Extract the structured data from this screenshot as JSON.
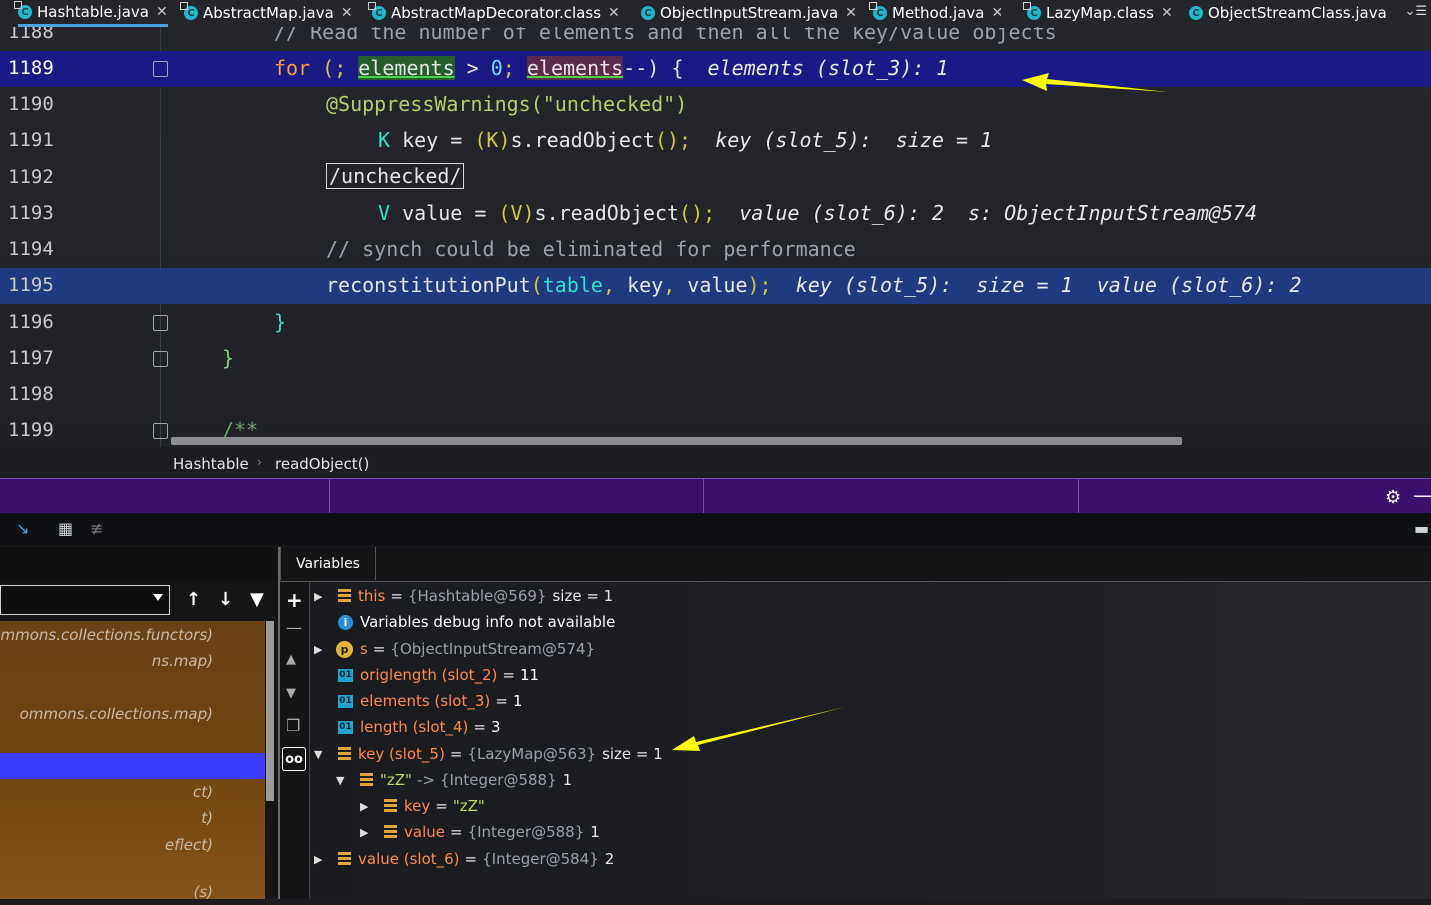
{
  "tabs": [
    {
      "label": "Hashtable.java",
      "active": true
    },
    {
      "label": "AbstractMap.java"
    },
    {
      "label": "AbstractMapDecorator.class"
    },
    {
      "label": "ObjectInputStream.java"
    },
    {
      "label": "Method.java"
    },
    {
      "label": "LazyMap.class"
    },
    {
      "label": "ObjectStreamClass.java"
    }
  ],
  "editor": {
    "lines": {
      "l1188": {
        "num": "1188",
        "comment": "// Read the number of elements and then all the key/value objects"
      },
      "l1189": {
        "num": "1189",
        "kw_for": "for",
        "p1": "(; ",
        "v1": "elements",
        "op1": " > ",
        "n0": "0",
        "sc": "; ",
        "v2": "elements",
        "op2": "--) {",
        "hint": "elements (slot_3): 1"
      },
      "l1190": {
        "num": "1190",
        "annotation": "@SuppressWarnings",
        "ann_arg": "(\"unchecked\")"
      },
      "l1191": {
        "num": "1191",
        "type": "K",
        "rest1": " key = ",
        "cast": "(K)",
        "call": "s.readObject",
        "paren": "();",
        "hint": "key (slot_5):  size = 1"
      },
      "l1192": {
        "num": "1192",
        "boxed": "/unchecked/"
      },
      "l1193": {
        "num": "1193",
        "type": "V",
        "rest1": " value = ",
        "cast": "(V)",
        "call": "s.readObject",
        "paren": "();",
        "hint": "value (slot_6): 2  s: ObjectInputStream@574"
      },
      "l1194": {
        "num": "1194",
        "comment": "// synch could be eliminated for performance"
      },
      "l1195": {
        "num": "1195",
        "call": "reconstitutionPut",
        "open": "(",
        "a1": "table",
        "c1": ", ",
        "a2": "key",
        "c2": ", ",
        "a3": "value",
        "close": ");",
        "hint": "key (slot_5):  size = 1  value (slot_6): 2"
      },
      "l1196": {
        "num": "1196",
        "code": "}"
      },
      "l1197": {
        "num": "1197",
        "code": "}"
      },
      "l1198": {
        "num": "1198",
        "code": ""
      },
      "l1199": {
        "num": "1199",
        "code": "/**"
      }
    }
  },
  "breadcrumb": {
    "item1": "Hashtable",
    "sep": "›",
    "item2": "readObject()"
  },
  "variables_panel": {
    "tab_label": "Variables",
    "rows": {
      "r_this": {
        "name": "this",
        "eq": "=",
        "type": "{Hashtable@569}",
        "val": "size = 1"
      },
      "r_info": {
        "text": "Variables debug info not available"
      },
      "r_s": {
        "name": "s",
        "eq": "=",
        "type": "{ObjectInputStream@574}"
      },
      "r_orig": {
        "name": "origlength (slot_2)",
        "eq": "=",
        "val": "11"
      },
      "r_elem": {
        "name": "elements (slot_3)",
        "eq": "=",
        "val": "1"
      },
      "r_len": {
        "name": "length (slot_4)",
        "eq": "=",
        "val": "3"
      },
      "r_key": {
        "name": "key (slot_5)",
        "eq": "=",
        "type": "{LazyMap@563}",
        "val": "size = 1"
      },
      "r_zz": {
        "name": "\"zZ\"",
        "eq": "->",
        "type": "{Integer@588}",
        "val": "1"
      },
      "r_k": {
        "name": "key",
        "eq": "=",
        "val": "\"zZ\""
      },
      "r_v": {
        "name": "value",
        "eq": "=",
        "type": "{Integer@588}",
        "val": "1"
      },
      "r_value": {
        "name": "value (slot_6)",
        "eq": "=",
        "type": "{Integer@584}",
        "val": "2"
      }
    }
  },
  "frames_panel": {
    "items": [
      "ommons.collections.functors)",
      "ns.map)",
      "",
      "ommons.collections.map)",
      "",
      "",
      "ct)",
      "t)",
      "eflect)",
      "(s)"
    ]
  },
  "colors": {
    "accent": "#4aa3df",
    "current_line": "#1a1a86",
    "debug_header": "#3b0f6c",
    "selected_frame": "#3c3cff",
    "annotation_arrow": "#ffff00"
  },
  "icons": {
    "gear": "gear-icon",
    "watch": "glasses-icon",
    "filter": "filter-icon"
  }
}
